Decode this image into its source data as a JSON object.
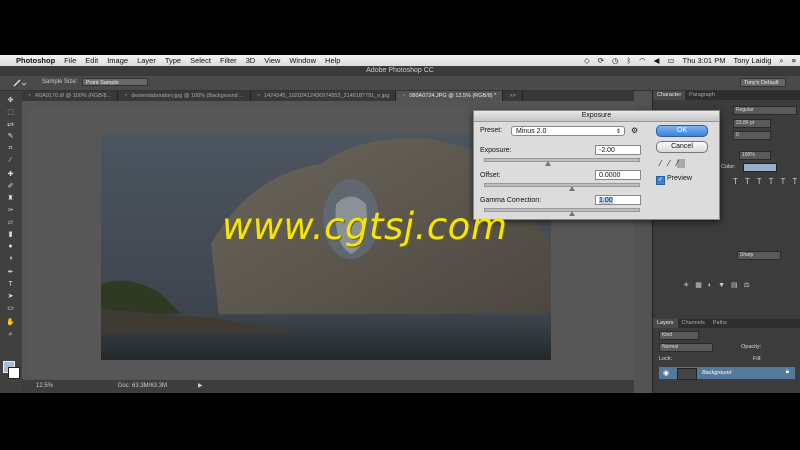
{
  "menubar": {
    "app": "Photoshop",
    "items": [
      "File",
      "Edit",
      "Image",
      "Layer",
      "Type",
      "Select",
      "Filter",
      "3D",
      "View",
      "Window",
      "Help"
    ],
    "clock": "Thu 3:01 PM",
    "user": "Tony Laidig"
  },
  "window": {
    "title": "Adobe Photoshop CC"
  },
  "options": {
    "sample_label": "Sample Size:",
    "sample_value": "Point Sample",
    "workspace": "Tony's Default"
  },
  "tabs": [
    {
      "label": "R0A9170.tif @ 100% (RGB/8...",
      "active": false
    },
    {
      "label": "dexterslaboratory.jpg @ 100% (Background ...",
      "active": false
    },
    {
      "label": "1424345_10202412436974553_2145187791_n.jpg",
      "active": false
    },
    {
      "label": "080A0724.JPG @ 12.5% (RGB/8) *",
      "active": true
    }
  ],
  "tabs_overflow": ">>",
  "status": {
    "zoom": "12.5%",
    "doc": "Doc: 63.3M/63.3M",
    "arrow": "▶"
  },
  "panels": {
    "top_tabs": [
      "Character",
      "Paragraph"
    ],
    "regular": "Regular",
    "size": "23.86 pt",
    "zero": "0",
    "scale": "100%",
    "color_label": "Color:",
    "sharp": "Sharp",
    "layer_tabs": [
      "Layers",
      "Channels",
      "Paths"
    ],
    "kind": "Kind",
    "normal": "Normal",
    "opacity_label": "Opacity:",
    "lock_label": "Lock:",
    "fill_label": "Fill:",
    "layer_name": "Background"
  },
  "dialog": {
    "title": "Exposure",
    "preset_label": "Preset:",
    "preset_value": "Minus 2.0",
    "exposure_label": "Exposure:",
    "exposure_value": "-2.00",
    "offset_label": "Offset:",
    "offset_value": "0.0000",
    "gamma_label": "Gamma Correction:",
    "gamma_value": "1.00",
    "ok": "OK",
    "cancel": "Cancel",
    "preview": "Preview",
    "preview_checked": true
  },
  "watermark": "www.cgtsj.com"
}
